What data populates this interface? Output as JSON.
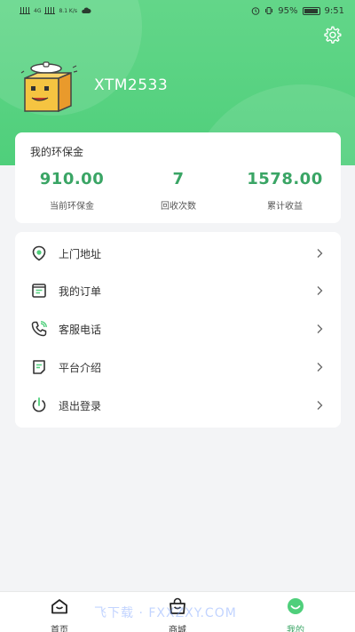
{
  "status_bar": {
    "left_text": "4G",
    "speed": "8.1 K/s",
    "battery": "95%",
    "time": "9:51"
  },
  "profile": {
    "username": "XTM2533"
  },
  "wallet": {
    "title": "我的环保金",
    "stats": [
      {
        "value": "910.00",
        "label": "当前环保金"
      },
      {
        "value": "7",
        "label": "回收次数"
      },
      {
        "value": "1578.00",
        "label": "累计收益"
      }
    ]
  },
  "menu": [
    {
      "label": "上门地址",
      "icon": "location-pin-icon"
    },
    {
      "label": "我的订单",
      "icon": "receipt-icon"
    },
    {
      "label": "客服电话",
      "icon": "phone-icon"
    },
    {
      "label": "平台介绍",
      "icon": "document-icon"
    },
    {
      "label": "退出登录",
      "icon": "power-icon"
    }
  ],
  "tabbar": [
    {
      "label": "首页",
      "icon": "home-icon",
      "active": false
    },
    {
      "label": "商城",
      "icon": "shop-bag-icon",
      "active": false
    },
    {
      "label": "我的",
      "icon": "profile-smile-icon",
      "active": true
    }
  ],
  "watermark": "飞下载 · FXXZXY.COM",
  "colors": {
    "brand_green": "#4fcf7b",
    "value_green": "#3aa565",
    "background": "#f3f4f6"
  }
}
